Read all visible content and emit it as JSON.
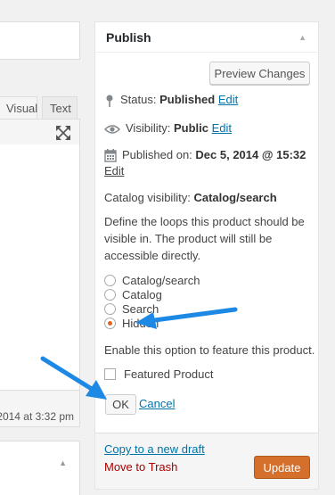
{
  "editor": {
    "tabs": [
      {
        "label": "Visual"
      },
      {
        "label": "Text"
      }
    ],
    "last_edited": "2014 at 3:32 pm"
  },
  "publish": {
    "title": "Publish",
    "preview_label": "Preview Changes",
    "status_label": "Status:",
    "status_value": "Published",
    "visibility_label": "Visibility:",
    "visibility_value": "Public",
    "published_label": "Published on:",
    "published_value": "Dec 5, 2014 @ 15:32",
    "edit_label": "Edit",
    "catalog_visibility_label": "Catalog visibility:",
    "catalog_visibility_value": "Catalog/search",
    "loops_description": "Define the loops this product should be visible in. The product will still be accessible directly.",
    "visibility_options": [
      {
        "label": "Catalog/search",
        "checked": false
      },
      {
        "label": "Catalog",
        "checked": false
      },
      {
        "label": "Search",
        "checked": false
      },
      {
        "label": "Hidden",
        "checked": true
      }
    ],
    "feature_description": "Enable this option to feature this product.",
    "featured_label": "Featured Product",
    "featured_checked": false,
    "ok_label": "OK",
    "cancel_label": "Cancel",
    "copy_draft_label": "Copy to a new draft",
    "trash_label": "Move to Trash",
    "update_label": "Update"
  },
  "colors": {
    "accent_link": "#0073aa",
    "update_button": "#d46f2c",
    "trash_link": "#aa0000",
    "annotation_arrow": "#1e88e5",
    "radio_checked": "#e0661a"
  },
  "icons": [
    "pin-icon",
    "eye-icon",
    "calendar-icon",
    "fullscreen-icon",
    "arrow-annotation"
  ]
}
